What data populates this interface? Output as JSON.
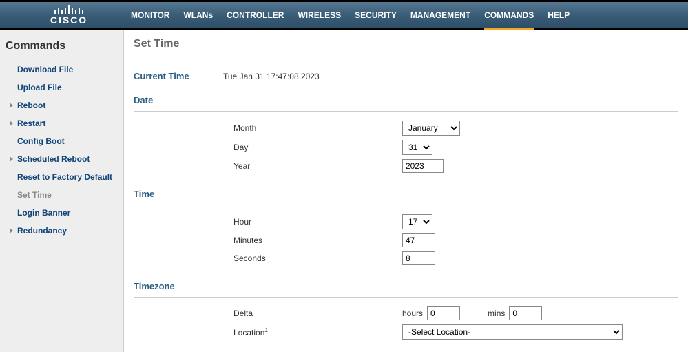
{
  "header": {
    "brand": "CISCO",
    "nav": [
      {
        "label": "MONITOR",
        "hotkey": "M"
      },
      {
        "label": "WLANs",
        "hotkey": "W"
      },
      {
        "label": "CONTROLLER",
        "hotkey": "C"
      },
      {
        "label": "WIRELESS",
        "hotkey": ""
      },
      {
        "label": "SECURITY",
        "hotkey": "S"
      },
      {
        "label": "MANAGEMENT",
        "hotkey": ""
      },
      {
        "label": "COMMANDS",
        "hotkey": ""
      },
      {
        "label": "HELP",
        "hotkey": ""
      }
    ],
    "active_nav": "COMMANDS"
  },
  "sidebar": {
    "title": "Commands",
    "items": [
      {
        "label": "Download File",
        "expandable": false
      },
      {
        "label": "Upload File",
        "expandable": false
      },
      {
        "label": "Reboot",
        "expandable": true
      },
      {
        "label": "Restart",
        "expandable": true
      },
      {
        "label": "Config Boot",
        "expandable": false
      },
      {
        "label": "Scheduled Reboot",
        "expandable": true
      },
      {
        "label": "Reset to Factory Default",
        "expandable": false
      },
      {
        "label": "Set Time",
        "expandable": false,
        "active": true
      },
      {
        "label": "Login Banner",
        "expandable": false
      },
      {
        "label": "Redundancy",
        "expandable": true
      }
    ]
  },
  "page": {
    "title": "Set Time",
    "current_time_label": "Current Time",
    "current_time_value": "Tue Jan 31 17:47:08 2023",
    "sections": {
      "date": "Date",
      "time": "Time",
      "timezone": "Timezone"
    },
    "fields": {
      "month": {
        "label": "Month",
        "value": "January"
      },
      "day": {
        "label": "Day",
        "value": "31"
      },
      "year": {
        "label": "Year",
        "value": "2023"
      },
      "hour": {
        "label": "Hour",
        "value": "17"
      },
      "minutes": {
        "label": "Minutes",
        "value": "47"
      },
      "seconds": {
        "label": "Seconds",
        "value": "8"
      },
      "delta": {
        "label": "Delta",
        "hours_label": "hours",
        "hours_value": "0",
        "mins_label": "mins",
        "mins_value": "0"
      },
      "location": {
        "label": "Location",
        "footnote": "1",
        "value": "-Select Location-"
      }
    }
  }
}
